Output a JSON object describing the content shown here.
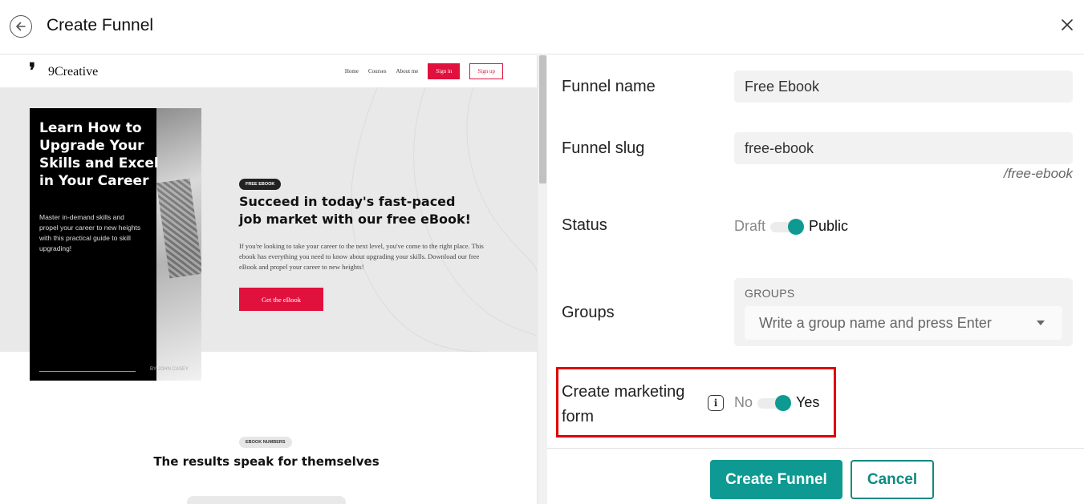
{
  "header": {
    "title": "Create Funnel",
    "back_icon": "arrow-left-circle-icon",
    "close_icon": "close-icon"
  },
  "preview": {
    "logo": "9Creative",
    "nav": [
      "Home",
      "Courses",
      "About me"
    ],
    "sign_in": "Sign in",
    "sign_up": "Sign up",
    "book_title": "Learn How to Upgrade Your Skills and Excel in Your Career",
    "book_subtitle": "Master in-demand skills and propel your career to new heights with this practical guide to skill upgrading!",
    "book_author": "BY JOHN CASEY",
    "badge": "FREE EBOOK",
    "heading": "Succeed in today's fast-paced job market with our free eBook!",
    "text": "If you're looking to take your career to the next level, you've come to the right place. This ebook has everything you need to know about upgrading your skills. Download our free eBook and propel your career to new heights!",
    "cta": "Get the eBook",
    "badge2": "EBOOK NUMBERS",
    "heading2": "The results speak for themselves"
  },
  "form": {
    "funnel_name_label": "Funnel name",
    "funnel_name_value": "Free Ebook",
    "funnel_slug_label": "Funnel slug",
    "funnel_slug_value": "free-ebook",
    "slug_hint": "/free-ebook",
    "status_label": "Status",
    "status_off": "Draft",
    "status_on": "Public",
    "groups_label": "Groups",
    "groups_caption": "GROUPS",
    "groups_placeholder": "Write a group name and press Enter",
    "marketing_label": "Create marketing form",
    "marketing_off": "No",
    "marketing_on": "Yes"
  },
  "footer": {
    "create_label": "Create Funnel",
    "cancel_label": "Cancel"
  },
  "colors": {
    "accent": "#0e9a92",
    "preview_brand": "#e0113d",
    "highlight": "#e00000"
  }
}
